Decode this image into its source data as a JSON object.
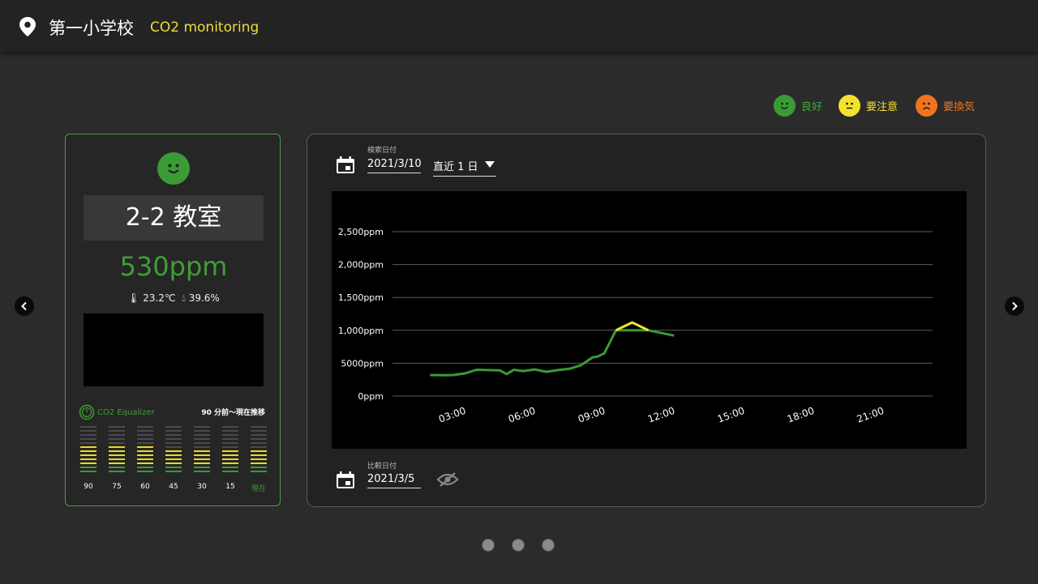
{
  "header": {
    "school": "第一小学校",
    "subtitle": "CO2 monitoring"
  },
  "legend": [
    {
      "label": "良好",
      "color": "#3a9b36",
      "face": "smile"
    },
    {
      "label": "要注意",
      "color": "#f2e22e",
      "face": "neutral"
    },
    {
      "label": "要換気",
      "color": "#f0731e",
      "face": "frown"
    }
  ],
  "card": {
    "room": "2-2 教室",
    "ppm": "530ppm",
    "temperature": "23.2℃",
    "humidity": "39.6%",
    "equalizer_title": "CO2 Equalizer",
    "equalizer_note": "90 分前～現在推移",
    "equalizer_ticks": [
      "90",
      "75",
      "60",
      "45",
      "30",
      "15",
      "現在"
    ],
    "equalizer_levels": [
      7,
      7,
      7,
      6,
      6,
      6,
      6
    ]
  },
  "panel": {
    "search_label": "検索日付",
    "search_date": "2021/3/10",
    "range": "直近 1 日",
    "compare_label": "比較日付",
    "compare_date": "2021/3/5"
  },
  "chart_data": {
    "type": "line",
    "y_ticks": [
      "0ppm",
      "5000ppm",
      "1,000ppm",
      "1,500ppm",
      "2,000ppm",
      "2,500ppm"
    ],
    "y_values": [
      0,
      500,
      1000,
      1500,
      2000,
      2500
    ],
    "x_ticks": [
      "03:00",
      "06:00",
      "09:00",
      "12:00",
      "15:00",
      "18:00",
      "21:00"
    ],
    "x_tick_hours": [
      3,
      6,
      9,
      12,
      15,
      18,
      21
    ],
    "ylim": [
      0,
      2500
    ],
    "grid": true,
    "series": [
      {
        "color": "#3a9b36",
        "points": [
          [
            2,
            320
          ],
          [
            2.5,
            318
          ],
          [
            3,
            320
          ],
          [
            3.5,
            345
          ],
          [
            4,
            400
          ],
          [
            4.5,
            395
          ],
          [
            5,
            390
          ],
          [
            5.3,
            335
          ],
          [
            5.6,
            400
          ],
          [
            6,
            380
          ],
          [
            6.5,
            405
          ],
          [
            7,
            370
          ],
          [
            7.5,
            395
          ],
          [
            8,
            415
          ],
          [
            8.5,
            470
          ],
          [
            9,
            590
          ],
          [
            9.2,
            600
          ],
          [
            9.5,
            650
          ],
          [
            10,
            1000
          ],
          [
            11.4,
            1000
          ],
          [
            12.5,
            920
          ]
        ]
      },
      {
        "color": "#f2e22e",
        "points": [
          [
            10,
            1000
          ],
          [
            10.7,
            1120
          ],
          [
            11.4,
            1000
          ]
        ]
      }
    ]
  },
  "pager": {
    "count": 3
  }
}
